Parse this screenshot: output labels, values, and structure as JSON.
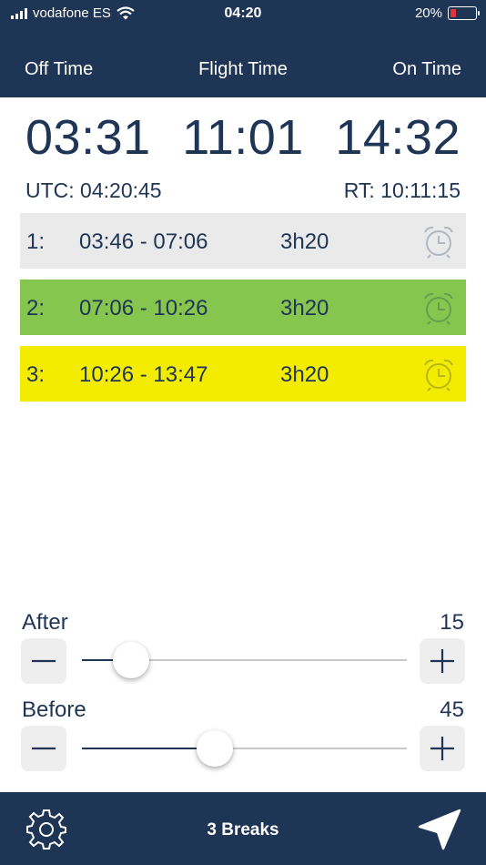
{
  "status": {
    "carrier": "vodafone ES",
    "time": "04:20",
    "battery_percent": "20%",
    "battery_level": 0.2,
    "battery_color": "#e8303b"
  },
  "header": {
    "off_label": "Off Time",
    "flight_label": "Flight Time",
    "on_label": "On Time"
  },
  "times": {
    "off": "03:31",
    "flight": "11:01",
    "on": "14:32",
    "utc": "UTC: 04:20:45",
    "rt": "RT: 10:11:15"
  },
  "breaks": [
    {
      "num": "1:",
      "range": "03:46 - 07:06",
      "duration": "3h20",
      "color": "#eaeaea",
      "icon": "alarm-clock-icon"
    },
    {
      "num": "2:",
      "range": "07:06 - 10:26",
      "duration": "3h20",
      "color": "#86c64f",
      "icon": "alarm-clock-icon"
    },
    {
      "num": "3:",
      "range": "10:26 - 13:47",
      "duration": "3h20",
      "color": "#f4ec00",
      "icon": "alarm-clock-icon"
    }
  ],
  "sliders": {
    "after": {
      "label": "After",
      "value": "15",
      "fraction": 0.15
    },
    "before": {
      "label": "Before",
      "value": "45",
      "fraction": 0.41
    }
  },
  "footer": {
    "breaks_label": "3 Breaks",
    "left_icon": "gear-icon",
    "right_icon": "send-icon"
  },
  "colors": {
    "navy": "#1f3556",
    "text": "#1e3556"
  }
}
